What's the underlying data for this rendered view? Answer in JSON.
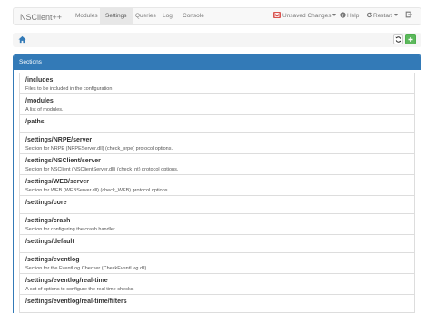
{
  "navbar": {
    "brand": "NSClient++",
    "items": [
      {
        "label": "Modules"
      },
      {
        "label": "Settings"
      },
      {
        "label": "Queries"
      },
      {
        "label": "Log"
      },
      {
        "label": "Console"
      }
    ],
    "active": "Settings",
    "unsaved_label": "Unsaved Changes",
    "help_label": "Help",
    "restart_label": "Restart"
  },
  "panel": {
    "title": "Sections",
    "items": [
      {
        "title": "/includes",
        "desc": "Files to be included in the configuration"
      },
      {
        "title": "/modules",
        "desc": "A list of modules."
      },
      {
        "title": "/paths",
        "desc": ""
      },
      {
        "title": "/settings/NRPE/server",
        "desc": "Section for NRPE (NRPEServer.dll) (check_nrpe) protocol options."
      },
      {
        "title": "/settings/NSClient/server",
        "desc": "Section for NSClient (NSClientServer.dll) (check_nt) protocol options."
      },
      {
        "title": "/settings/WEB/server",
        "desc": "Section for WEB (WEBServer.dll) (check_WEB) protocol options."
      },
      {
        "title": "/settings/core",
        "desc": ""
      },
      {
        "title": "/settings/crash",
        "desc": "Section for configuring the crash handler."
      },
      {
        "title": "/settings/default",
        "desc": ""
      },
      {
        "title": "/settings/eventlog",
        "desc": "Section for the EventLog Checker (CheckEventLog.dll)."
      },
      {
        "title": "/settings/eventlog/real-time",
        "desc": "A set of options to configure the real time checks"
      },
      {
        "title": "/settings/eventlog/real-time/filters",
        "desc": ""
      }
    ]
  },
  "colors": {
    "primary": "#337ab7",
    "success": "#5cb85c",
    "danger": "#d9534f"
  }
}
